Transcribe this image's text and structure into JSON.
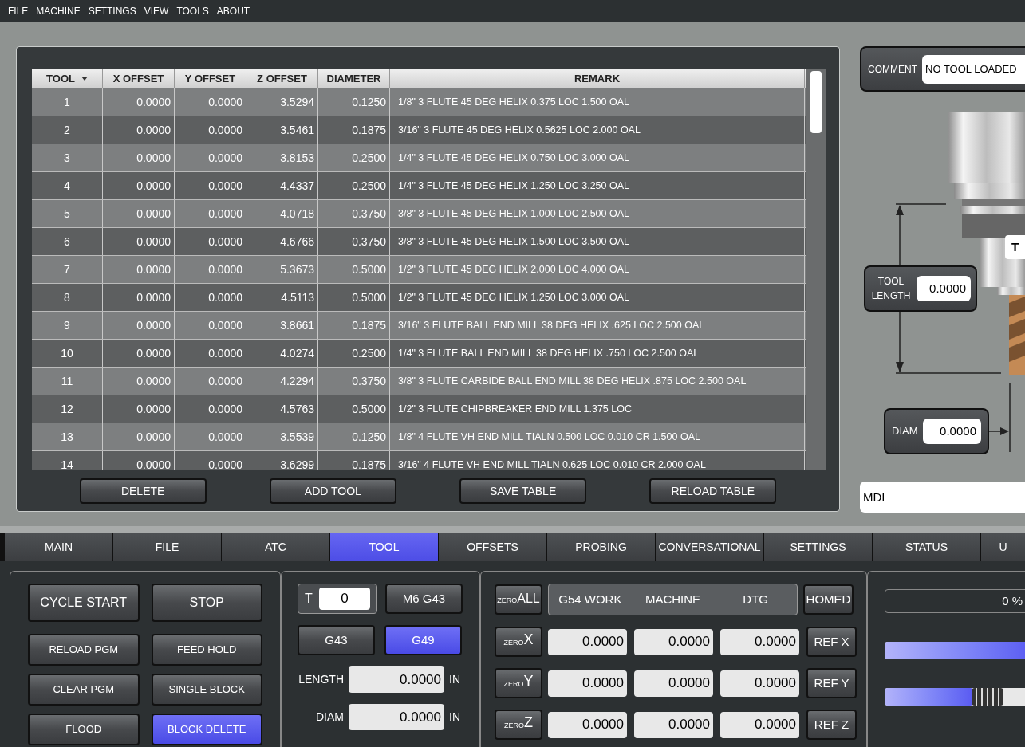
{
  "menu": [
    "FILE",
    "MACHINE",
    "SETTINGS",
    "VIEW",
    "TOOLS",
    "ABOUT"
  ],
  "tool_table": {
    "columns": [
      {
        "label": "TOOL",
        "sorted": true
      },
      {
        "label": "X OFFSET",
        "sorted": false
      },
      {
        "label": "Y OFFSET",
        "sorted": false
      },
      {
        "label": "Z OFFSET",
        "sorted": false
      },
      {
        "label": "DIAMETER",
        "sorted": false
      },
      {
        "label": "REMARK",
        "sorted": false
      }
    ],
    "rows": [
      [
        "1",
        "0.0000",
        "0.0000",
        "3.5294",
        "0.1250",
        "1/8\" 3 FLUTE 45 DEG HELIX 0.375 LOC 1.500 OAL"
      ],
      [
        "2",
        "0.0000",
        "0.0000",
        "3.5461",
        "0.1875",
        "3/16\" 3 FLUTE 45 DEG HELIX 0.5625 LOC 2.000 OAL"
      ],
      [
        "3",
        "0.0000",
        "0.0000",
        "3.8153",
        "0.2500",
        "1/4\" 3 FLUTE 45 DEG HELIX 0.750 LOC 3.000 OAL"
      ],
      [
        "4",
        "0.0000",
        "0.0000",
        "4.4337",
        "0.2500",
        "1/4\" 3 FLUTE 45 DEG HELIX 1.250 LOC 3.250 OAL"
      ],
      [
        "5",
        "0.0000",
        "0.0000",
        "4.0718",
        "0.3750",
        "3/8\" 3 FLUTE 45 DEG HELIX 1.000 LOC 2.500 OAL"
      ],
      [
        "6",
        "0.0000",
        "0.0000",
        "4.6766",
        "0.3750",
        "3/8\" 3 FLUTE 45 DEG HELIX 1.500 LOC 3.500 OAL"
      ],
      [
        "7",
        "0.0000",
        "0.0000",
        "5.3673",
        "0.5000",
        "1/2\" 3 FLUTE 45 DEG HELIX 2.000 LOC 4.000 OAL"
      ],
      [
        "8",
        "0.0000",
        "0.0000",
        "4.5113",
        "0.5000",
        "1/2\" 3 FLUTE 45 DEG HELIX 1.250 LOC 3.000 OAL"
      ],
      [
        "9",
        "0.0000",
        "0.0000",
        "3.8661",
        "0.1875",
        "3/16\" 3 FLUTE BALL END MILL 38 DEG HELIX .625 LOC 2.500 OAL"
      ],
      [
        "10",
        "0.0000",
        "0.0000",
        "4.0274",
        "0.2500",
        "1/4\" 3 FLUTE BALL END MILL 38 DEG HELIX .750 LOC 2.500 OAL"
      ],
      [
        "11",
        "0.0000",
        "0.0000",
        "4.2294",
        "0.3750",
        "3/8\" 3 FLUTE CARBIDE BALL END MILL 38 DEG HELIX .875 LOC 2.500 OAL"
      ],
      [
        "12",
        "0.0000",
        "0.0000",
        "4.5763",
        "0.5000",
        "1/2\" 3 FLUTE CHIPBREAKER END MILL 1.375 LOC"
      ],
      [
        "13",
        "0.0000",
        "0.0000",
        "3.5539",
        "0.1250",
        "1/8\" 4 FLUTE VH END MILL TIALN 0.500 LOC 0.010 CR 1.500 OAL"
      ],
      [
        "14",
        "0.0000",
        "0.0000",
        "3.6299",
        "0.1875",
        "3/16\" 4 FLUTE VH END MILL TIALN 0.625 LOC 0.010 CR 2.000 OAL"
      ]
    ]
  },
  "table_buttons": [
    "DELETE",
    "ADD TOOL",
    "SAVE TABLE",
    "RELOAD TABLE"
  ],
  "comment": {
    "label": "COMMENT",
    "value": "NO TOOL LOADED"
  },
  "tool_tag": "T",
  "tool_length": {
    "label": "TOOL LENGTH",
    "value": "0.0000"
  },
  "tool_diam": {
    "label": "DIAM",
    "value": "0.0000"
  },
  "mdi": {
    "placeholder": "MDI"
  },
  "tabs": [
    {
      "label": "MAIN",
      "selected": false
    },
    {
      "label": "FILE",
      "selected": false
    },
    {
      "label": "ATC",
      "selected": false
    },
    {
      "label": "TOOL",
      "selected": true
    },
    {
      "label": "OFFSETS",
      "selected": false
    },
    {
      "label": "PROBING",
      "selected": false
    },
    {
      "label": "CONVERSATIONAL",
      "selected": false
    },
    {
      "label": "SETTINGS",
      "selected": false
    },
    {
      "label": "STATUS",
      "selected": false
    },
    {
      "label": "U",
      "selected": false
    }
  ],
  "run_buttons": [
    {
      "label": "CYCLE START",
      "on": false
    },
    {
      "label": "STOP",
      "on": false
    }
  ],
  "program_buttons": [
    {
      "label": "RELOAD PGM",
      "on": false
    },
    {
      "label": "FEED HOLD",
      "on": false
    },
    {
      "label": "CLEAR PGM",
      "on": false
    },
    {
      "label": "SINGLE BLOCK",
      "on": false
    },
    {
      "label": "FLOOD",
      "on": false
    },
    {
      "label": "BLOCK DELETE",
      "on": true
    }
  ],
  "tool_control": {
    "t_label": "T",
    "t_value": "0",
    "change_button": "M6 G43",
    "g_buttons": [
      {
        "label": "G43",
        "selected": false
      },
      {
        "label": "G49",
        "selected": true
      }
    ],
    "fields": [
      {
        "label": "LENGTH",
        "value": "0.0000",
        "unit": "IN"
      },
      {
        "label": "DIAM",
        "value": "0.0000",
        "unit": "IN"
      }
    ]
  },
  "dro": {
    "zero_all": {
      "small": "ZERO",
      "big": "ALL"
    },
    "headers": [
      "G54 WORK",
      "MACHINE",
      "DTG"
    ],
    "homed": "HOMED",
    "axes": [
      {
        "small": "ZERO",
        "axis": "X",
        "values": [
          "0.0000",
          "0.0000",
          "0.0000"
        ],
        "ref": "REF X"
      },
      {
        "small": "ZERO",
        "axis": "Y",
        "values": [
          "0.0000",
          "0.0000",
          "0.0000"
        ],
        "ref": "REF Y"
      },
      {
        "small": "ZERO",
        "axis": "Z",
        "values": [
          "0.0000",
          "0.0000",
          "0.0000"
        ],
        "ref": "REF Z"
      }
    ]
  },
  "overrides": {
    "progress": {
      "reading": "0 %",
      "level": 0
    },
    "sliders": [
      {
        "level": 0.62
      },
      {
        "level": 0.37
      }
    ]
  }
}
